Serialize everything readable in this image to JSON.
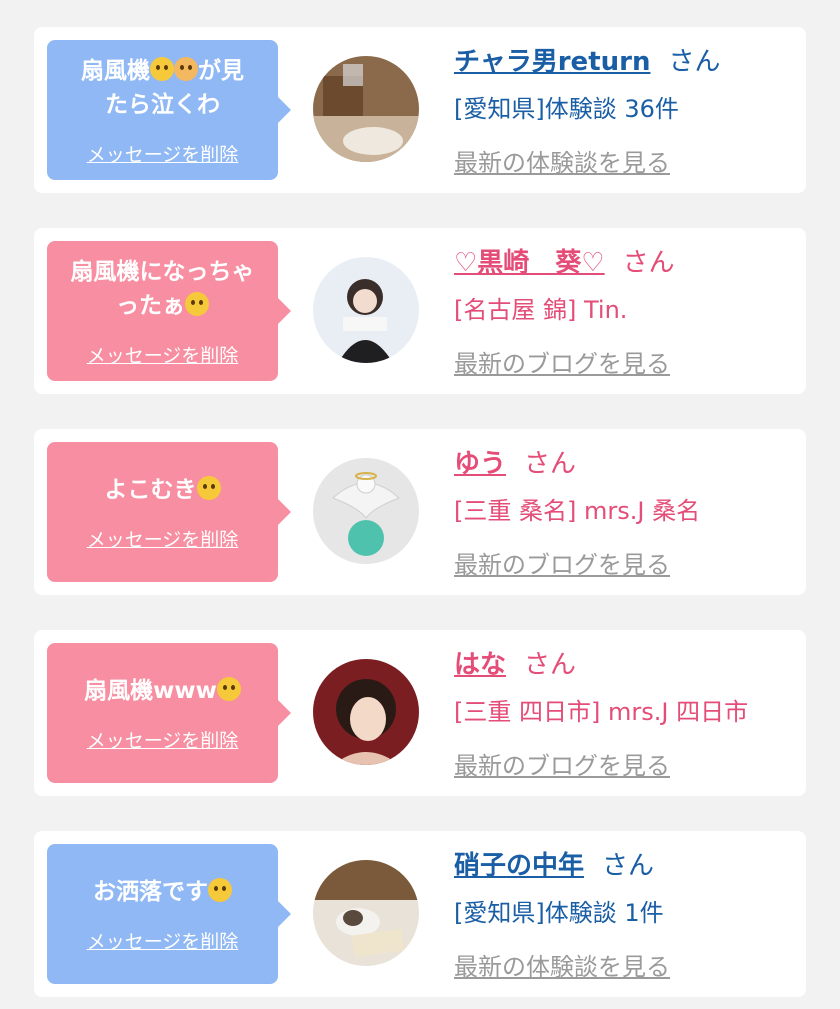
{
  "colors": {
    "blue_bubble": "#8fb8f4",
    "pink_bubble": "#f78ea1",
    "blue_text": "#1a5ea5",
    "pink_text": "#e44d77"
  },
  "cards": [
    {
      "message_line1": "扇風機",
      "emoji1": "rolling-laughing-emoji",
      "emoji2": "baby-emoji",
      "message_line1_tail": "が見",
      "message_line2": "たら泣くわ",
      "delete_label": "メッセージを削除",
      "name": "チャラ男return",
      "honorific": "さん",
      "sub": "[愛知県]体験談 36件",
      "more": "最新の体験談を見る"
    },
    {
      "message_line1": "扇風機になっちゃ",
      "message_line2": "ったぁ",
      "emoji1": "pleading-face-emoji",
      "delete_label": "メッセージを削除",
      "name": "♡黒崎　葵♡",
      "honorific": "さん",
      "sub": "[名古屋 錦] Tin.",
      "more": "最新のブログを見る"
    },
    {
      "message": "よこむき",
      "emoji1": "hand-over-mouth-emoji",
      "delete_label": "メッセージを削除",
      "name": "ゆう",
      "honorific": "さん",
      "sub": "[三重 桑名] mrs.J 桑名",
      "more": "最新のブログを見る"
    },
    {
      "message": "扇風機www",
      "emoji1": "tears-of-joy-emoji",
      "delete_label": "メッセージを削除",
      "name": "はな",
      "honorific": "さん",
      "sub": "[三重 四日市] mrs.J 四日市",
      "more": "最新のブログを見る"
    },
    {
      "message": "お洒落です",
      "emoji1": "pleading-face-emoji",
      "delete_label": "メッセージを削除",
      "name": "硝子の中年",
      "honorific": "さん",
      "sub": "[愛知県]体験談 1件",
      "more": "最新の体験談を見る"
    }
  ]
}
